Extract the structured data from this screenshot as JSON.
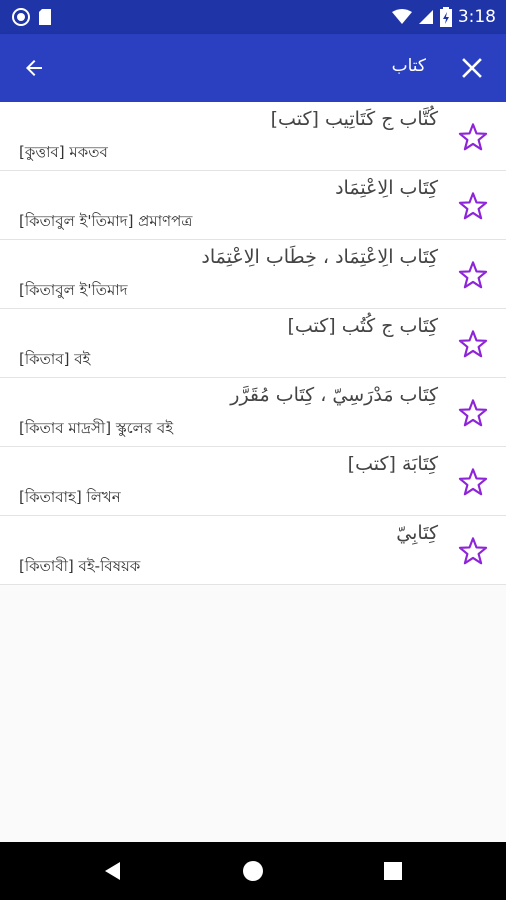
{
  "status_bar": {
    "time": "3:18"
  },
  "app_bar": {
    "search_query": "كتاب"
  },
  "colors": {
    "accent": "#2a40c0",
    "status": "#1f34a6",
    "star": "#8e24d8"
  },
  "results": [
    {
      "arabic": "كُتَّاب ج كَتَاتِيب [كتب]",
      "bengali": "[কুত্তাব] মকতব"
    },
    {
      "arabic": "كِتَاب الِاعْتِمَاد",
      "bengali": "[কিতাবুল ই'তিমাদ] প্রমাণপত্র"
    },
    {
      "arabic": "كِتَاب الِاعْتِمَاد ، خِطَاب الِاعْتِمَاد",
      "bengali": "[কিতাবুল ই'তিমাদ"
    },
    {
      "arabic": "كِتَاب ج كُتُب [كتب]",
      "bengali": "[কিতাব] বই"
    },
    {
      "arabic": "كِتَاب مَدْرَسِيّ ، كِتَاب مُقَرَّر",
      "bengali": "[কিতাব মাদ্রসী] স্কুলের বই"
    },
    {
      "arabic": "كِتَابَة [كتب]",
      "bengali": "[কিতাবাহ] লিখন"
    },
    {
      "arabic": "كِتَابِيّ",
      "bengali": "[কিতাবী] বই-বিষয়ক"
    }
  ]
}
